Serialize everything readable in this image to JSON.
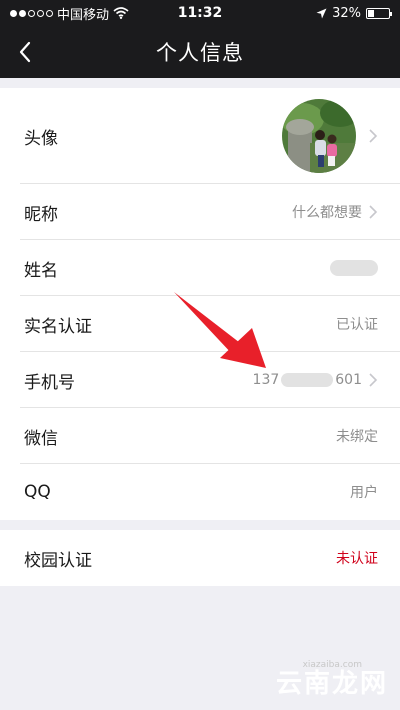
{
  "status_bar": {
    "carrier": "中国移动",
    "time": "11:32",
    "battery": "32%",
    "battery_level": 0.32
  },
  "nav": {
    "title": "个人信息"
  },
  "profile": {
    "avatar_label": "头像",
    "nickname_label": "昵称",
    "nickname_value": "什么都想要",
    "name_label": "姓名",
    "realname_label": "实名认证",
    "realname_value": "已认证",
    "phone_label": "手机号",
    "phone_prefix": "137",
    "phone_suffix": "601",
    "wechat_label": "微信",
    "wechat_value": "未绑定",
    "qq_label": "QQ",
    "qq_value": "用户"
  },
  "campus": {
    "label": "校园认证",
    "value": "未认证"
  },
  "watermark": {
    "text": "云南龙网",
    "sub": "xiazaiba.com"
  },
  "colors": {
    "header_bg": "#1b1b1d",
    "unverified": "#d0021b",
    "arrow": "#e8202a"
  }
}
